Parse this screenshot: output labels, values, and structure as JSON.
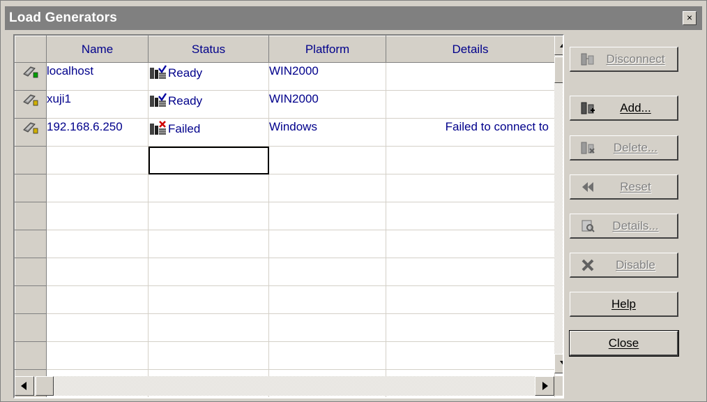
{
  "window": {
    "title": "Load Generators",
    "close_glyph": "×"
  },
  "grid": {
    "columns": [
      "Name",
      "Status",
      "Platform",
      "Details"
    ],
    "rows": [
      {
        "name": "localhost",
        "status": "Ready",
        "platform": "WIN2000",
        "details": "",
        "status_kind": "ready",
        "row_icon": "host-connected-icon"
      },
      {
        "name": "xuji1",
        "status": "Ready",
        "platform": "WIN2000",
        "details": "",
        "status_kind": "ready",
        "row_icon": "host-warning-icon"
      },
      {
        "name": "192.168.6.250",
        "status": "Failed",
        "platform": "Windows",
        "details": "Failed to connect to",
        "status_kind": "failed",
        "row_icon": "host-warning-icon"
      }
    ],
    "empty_rows": 9
  },
  "buttons": {
    "disconnect": {
      "label": "Disconnect",
      "icon": "disconnect-icon",
      "enabled": false
    },
    "add": {
      "label": "Add...",
      "icon": "add-host-icon",
      "enabled": true
    },
    "delete": {
      "label": "Delete...",
      "icon": "delete-host-icon",
      "enabled": false
    },
    "reset": {
      "label": "Reset",
      "icon": "rewind-icon",
      "enabled": false
    },
    "details": {
      "label": "Details...",
      "icon": "details-icon",
      "enabled": false
    },
    "disable": {
      "label": "Disable",
      "icon": "x-icon",
      "enabled": false
    },
    "help": {
      "label": "Help",
      "enabled": true
    },
    "close": {
      "label": "Close",
      "enabled": true
    }
  },
  "colors": {
    "header_text": "#00008b",
    "failed": "#c00000",
    "face": "#d4d0c8"
  }
}
